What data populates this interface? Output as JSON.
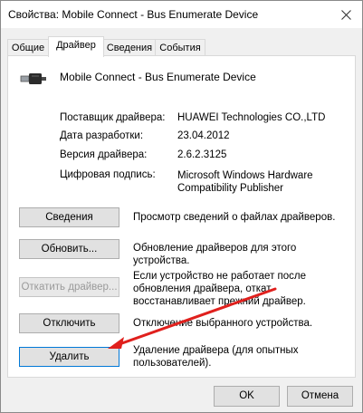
{
  "window": {
    "title": "Свойства: Mobile Connect - Bus Enumerate Device"
  },
  "tabs": [
    {
      "label": "Общие",
      "active": false
    },
    {
      "label": "Драйвер",
      "active": true
    },
    {
      "label": "Сведения",
      "active": false
    },
    {
      "label": "События",
      "active": false
    }
  ],
  "device": {
    "name": "Mobile Connect - Bus Enumerate Device",
    "icon": "usb-plug-icon"
  },
  "properties": {
    "provider_label": "Поставщик драйвера:",
    "provider_value": "HUAWEI Technologies CO.,LTD",
    "date_label": "Дата разработки:",
    "date_value": "23.04.2012",
    "version_label": "Версия драйвера:",
    "version_value": "2.6.2.3125",
    "signer_label": "Цифровая подпись:",
    "signer_value_line1": "Microsoft Windows Hardware",
    "signer_value_line2": "Compatibility Publisher"
  },
  "actions": {
    "details_button": "Сведения",
    "details_desc": "Просмотр сведений о файлах драйверов.",
    "update_button": "Обновить...",
    "update_desc": "Обновление драйверов для этого устройства.",
    "rollback_button": "Откатить драйвер...",
    "rollback_desc_line1": "Если устройство не работает после",
    "rollback_desc_line2": "обновления драйвера, откат",
    "rollback_desc_line3": "восстанавливает прежний драйвер.",
    "disable_button": "Отключить",
    "disable_desc": "Отключение выбранного устройства.",
    "uninstall_button": "Удалить",
    "uninstall_desc_line1": "Удаление драйвера (для опытных",
    "uninstall_desc_line2": "пользователей)."
  },
  "footer": {
    "ok_button": "OK",
    "cancel_button": "Отмена"
  },
  "colors": {
    "arrow": "#e0201d",
    "focus_border": "#0078d7"
  }
}
